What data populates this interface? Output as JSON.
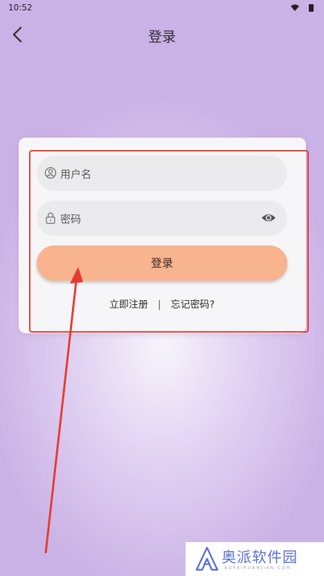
{
  "status_bar": {
    "time": "10:52",
    "icons": [
      "wifi-icon",
      "battery-icon"
    ]
  },
  "nav": {
    "title": "登录",
    "back_icon": "chevron-left-icon"
  },
  "form": {
    "username_placeholder": "用户名",
    "password_placeholder": "密码",
    "login_label": "登录",
    "register_label": "立即注册",
    "separator": "|",
    "forgot_label": "忘记密码?"
  },
  "watermark": {
    "name": "奥派软件园",
    "domain": "AUPAIRUANJIAN.COM"
  },
  "colors": {
    "login_button": "#f8b38f",
    "highlight": "#e43b30",
    "card": "#f6f5f7"
  }
}
